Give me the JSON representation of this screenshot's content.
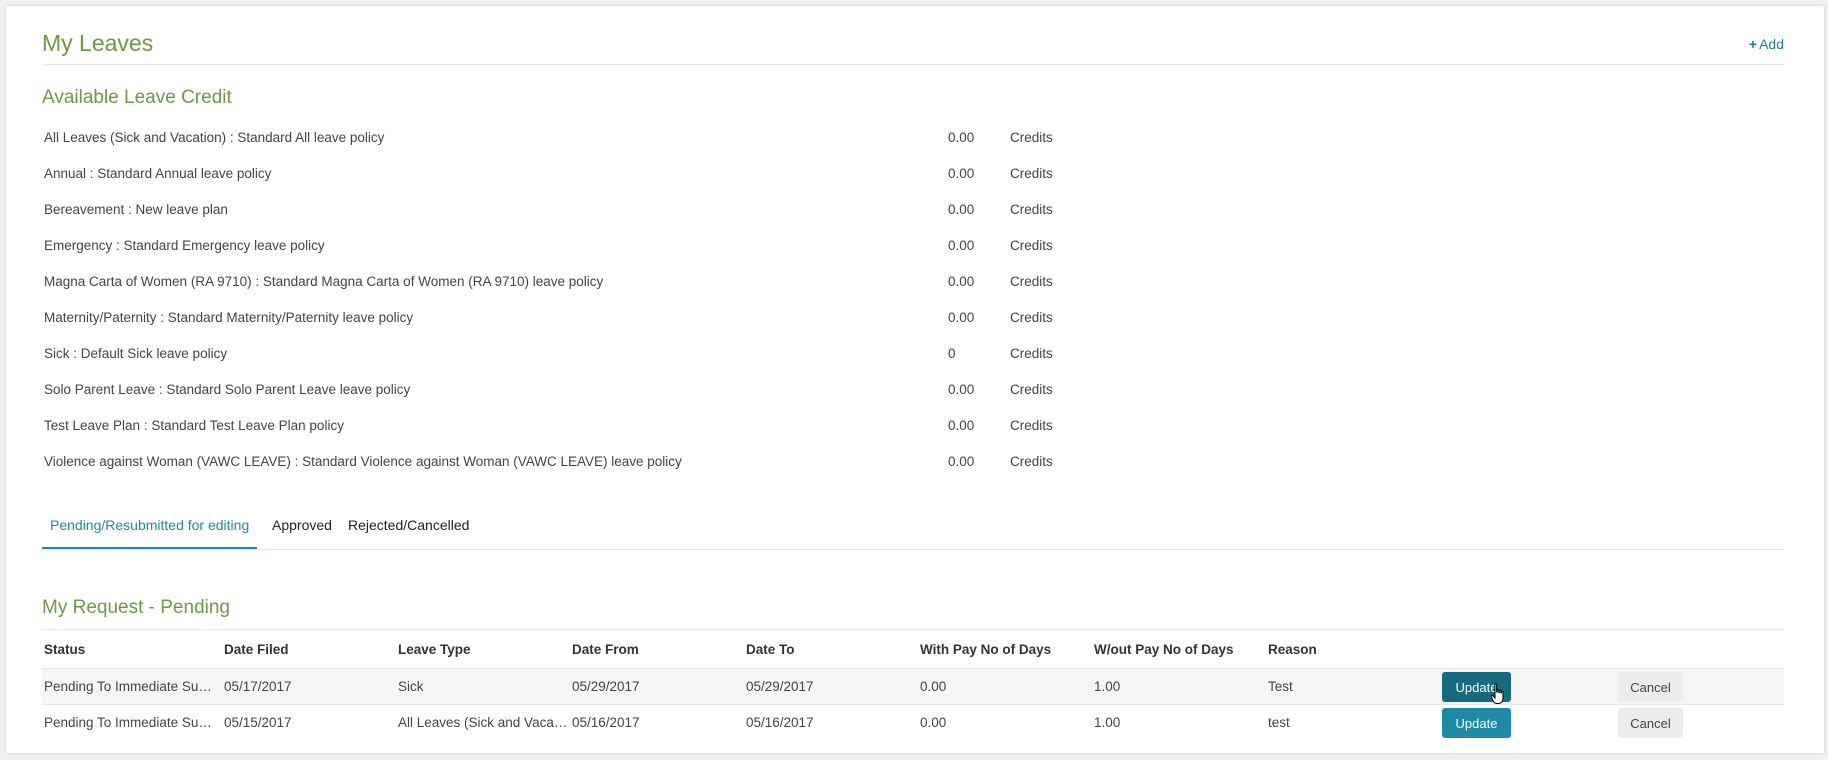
{
  "header": {
    "title": "My Leaves",
    "add_label": "Add"
  },
  "credits": {
    "title": "Available Leave Credit",
    "rows": [
      {
        "name": "All Leaves (Sick and Vacation) : Standard All leave policy",
        "value": "0.00",
        "unit": "Credits"
      },
      {
        "name": "Annual : Standard Annual leave policy",
        "value": "0.00",
        "unit": "Credits"
      },
      {
        "name": "Bereavement : New leave plan",
        "value": "0.00",
        "unit": "Credits"
      },
      {
        "name": "Emergency : Standard Emergency leave policy",
        "value": "0.00",
        "unit": "Credits"
      },
      {
        "name": "Magna Carta of Women (RA 9710) : Standard Magna Carta of Women (RA 9710) leave policy",
        "value": "0.00",
        "unit": "Credits"
      },
      {
        "name": "Maternity/Paternity : Standard Maternity/Paternity leave policy",
        "value": "0.00",
        "unit": "Credits"
      },
      {
        "name": "Sick : Default Sick leave policy",
        "value": "0",
        "unit": "Credits"
      },
      {
        "name": "Solo Parent Leave : Standard Solo Parent Leave leave policy",
        "value": "0.00",
        "unit": "Credits"
      },
      {
        "name": "Test Leave Plan : Standard Test Leave Plan policy",
        "value": "0.00",
        "unit": "Credits"
      },
      {
        "name": "Violence against Woman (VAWC LEAVE) : Standard Violence against Woman (VAWC LEAVE) leave policy",
        "value": "0.00",
        "unit": "Credits"
      }
    ]
  },
  "tabs": [
    {
      "label": "Pending/Resubmitted for editing",
      "active": true
    },
    {
      "label": "Approved",
      "active": false
    },
    {
      "label": "Rejected/Cancelled",
      "active": false
    }
  ],
  "requests": {
    "title": "My Request - Pending",
    "columns": [
      "Status",
      "Date Filed",
      "Leave Type",
      "Date From",
      "Date To",
      "With Pay No of Days",
      "W/out Pay No of Days",
      "Reason"
    ],
    "rows": [
      {
        "status": "Pending To Immediate Sup...",
        "date_filed": "05/17/2017",
        "leave_type": "Sick",
        "date_from": "05/29/2017",
        "date_to": "05/29/2017",
        "with_pay": "0.00",
        "without_pay": "1.00",
        "reason": "Test",
        "update_label": "Update",
        "cancel_label": "Cancel"
      },
      {
        "status": "Pending To Immediate Sup...",
        "date_filed": "05/15/2017",
        "leave_type": "All Leaves (Sick and Vacatio...",
        "date_from": "05/16/2017",
        "date_to": "05/16/2017",
        "with_pay": "0.00",
        "without_pay": "1.00",
        "reason": "test",
        "update_label": "Update",
        "cancel_label": "Cancel"
      }
    ]
  },
  "colors": {
    "accent_green": "#6b9a3f",
    "accent_teal": "#1e8aa3"
  }
}
